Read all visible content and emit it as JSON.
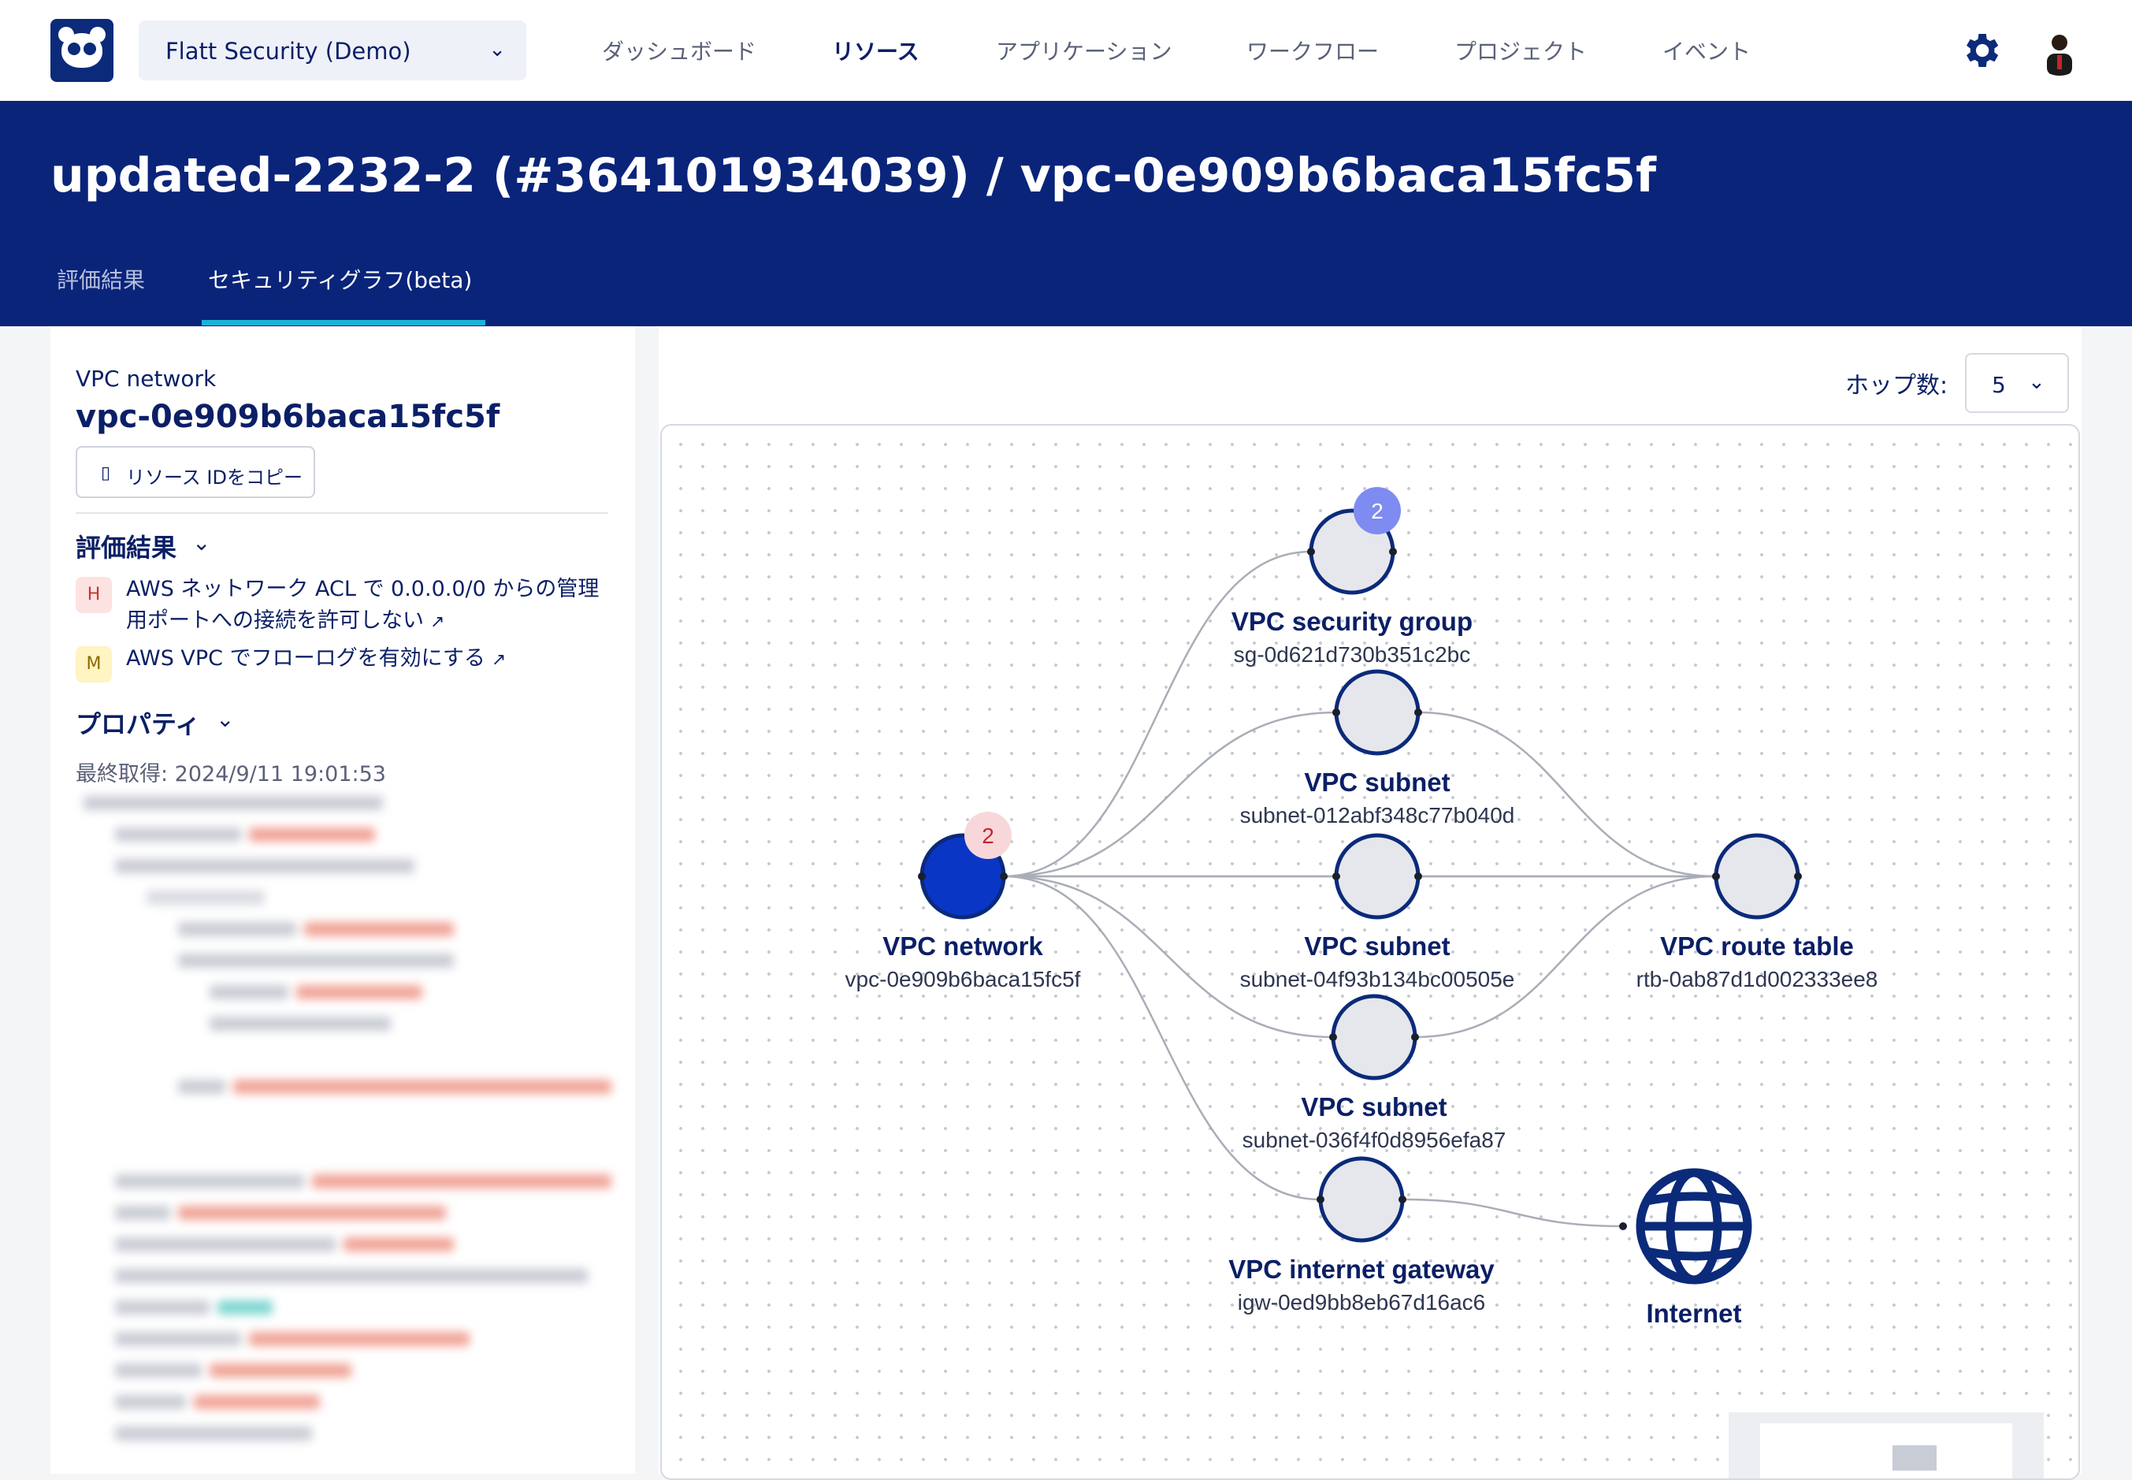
{
  "org": {
    "name": "Flatt Security (Demo)"
  },
  "nav": {
    "items": [
      "ダッシュボード",
      "リソース",
      "アプリケーション",
      "ワークフロー",
      "プロジェクト",
      "イベント"
    ],
    "active": "リソース"
  },
  "header": {
    "title": "updated-2232-2 (#364101934039) / vpc-0e909b6baca15fc5f",
    "tabs": [
      "評価結果",
      "セキュリティグラフ(beta)"
    ],
    "active_tab": "セキュリティグラフ(beta)"
  },
  "resource": {
    "type": "VPC network",
    "id": "vpc-0e909b6baca15fc5f",
    "copy_label": "リソース IDをコピー"
  },
  "findings": {
    "heading": "評価結果",
    "items": [
      {
        "severity": "H",
        "line1": "AWS ネットワーク ACL で 0.0.0.0/0 からの管理",
        "line2": "用ポートへの接続を許可しない"
      },
      {
        "severity": "M",
        "line1": "AWS VPC でフローログを有効にする"
      }
    ]
  },
  "properties": {
    "heading": "プロパティ",
    "last_fetched": "最終取得: 2024/9/11 19:01:53"
  },
  "graph_controls": {
    "hop_label": "ホップ数:",
    "hop_value": "5"
  },
  "graph": {
    "nodes": [
      {
        "id": "vpc",
        "title": "VPC network",
        "sub": "vpc-0e909b6baca15fc5f",
        "badge": "2",
        "badge_style": "danger",
        "fill": "#0a36c6"
      },
      {
        "id": "sg",
        "title": "VPC security group",
        "sub": "sg-0d621d730b351c2bc",
        "badge": "2",
        "badge_style": "info",
        "fill": "#e6e7ec"
      },
      {
        "id": "sub1",
        "title": "VPC subnet",
        "sub": "subnet-012abf348c77b040d",
        "fill": "#e6e7ec"
      },
      {
        "id": "sub2",
        "title": "VPC subnet",
        "sub": "subnet-04f93b134bc00505e",
        "fill": "#e6e7ec"
      },
      {
        "id": "sub3",
        "title": "VPC subnet",
        "sub": "subnet-036f4f0d8956efa87",
        "fill": "#e6e7ec"
      },
      {
        "id": "igw",
        "title": "VPC internet gateway",
        "sub": "igw-0ed9bb8eb67d16ac6",
        "fill": "#e6e7ec"
      },
      {
        "id": "rtb",
        "title": "VPC route table",
        "sub": "rtb-0ab87d1d002333ee8",
        "fill": "#e6e7ec"
      },
      {
        "id": "inet",
        "title": "Internet",
        "sub": "",
        "icon": "globe-icon"
      }
    ],
    "edges": [
      [
        "vpc",
        "sg"
      ],
      [
        "vpc",
        "sub1"
      ],
      [
        "vpc",
        "sub2"
      ],
      [
        "vpc",
        "sub3"
      ],
      [
        "vpc",
        "igw"
      ],
      [
        "vpc",
        "rtb"
      ],
      [
        "sub1",
        "rtb"
      ],
      [
        "sub2",
        "rtb"
      ],
      [
        "sub3",
        "rtb"
      ],
      [
        "igw",
        "inet"
      ]
    ]
  },
  "colors": {
    "brand": "#0a247a",
    "accent": "#1bb3d8",
    "node_primary": "#0a36c6"
  }
}
